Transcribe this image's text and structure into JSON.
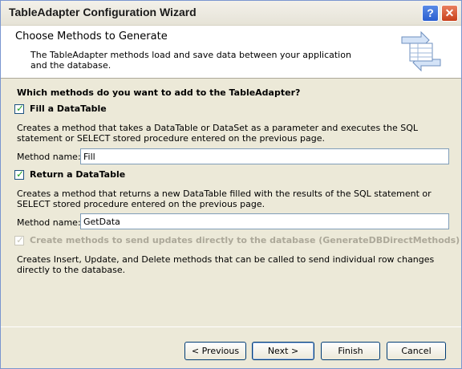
{
  "window": {
    "title": "TableAdapter Configuration Wizard",
    "help_glyph": "?",
    "close_glyph": "✕"
  },
  "header": {
    "title": "Choose Methods to Generate",
    "description": "The TableAdapter methods load and save data between your application and the database."
  },
  "content": {
    "question": "Which methods do you want to add to the TableAdapter?",
    "fill": {
      "label": "Fill a DataTable",
      "checked": true,
      "description": "Creates a method that takes a DataTable or DataSet as a parameter and executes the SQL statement or SELECT stored procedure entered on the previous page.",
      "method_name_label": "Method name:",
      "method_name_value": "Fill"
    },
    "return": {
      "label": "Return a DataTable",
      "checked": true,
      "description": "Creates a method that returns a new DataTable filled with the results of the SQL statement or SELECT stored procedure entered on the previous page.",
      "method_name_label": "Method name:",
      "method_name_value": "GetData"
    },
    "direct": {
      "label": "Create methods to send updates directly to the database (GenerateDBDirectMethods)",
      "checked": true,
      "disabled": true,
      "description": "Creates Insert, Update, and Delete methods that can be called to send individual row changes directly to the database."
    }
  },
  "buttons": {
    "previous": "< Previous",
    "next": "Next >",
    "finish": "Finish",
    "cancel": "Cancel"
  }
}
